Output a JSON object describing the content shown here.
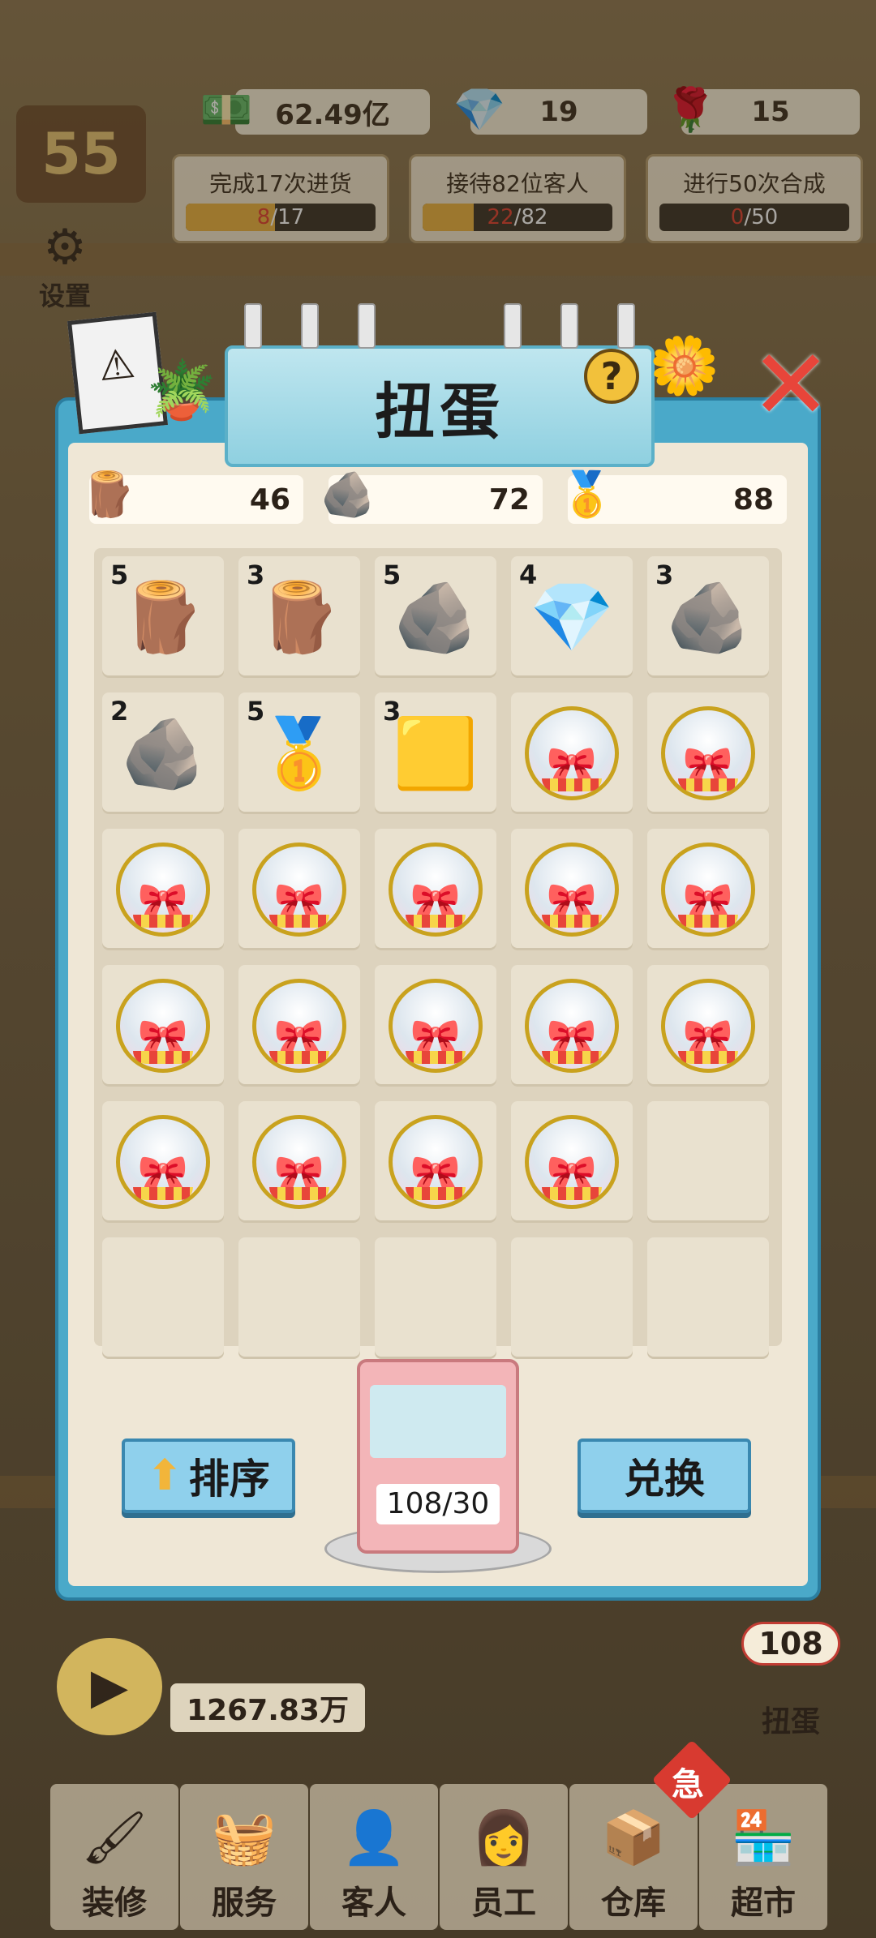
{
  "currency": {
    "money": "62.49亿",
    "gems": "19",
    "roses": "15"
  },
  "level": "55",
  "quests": [
    {
      "title": "完成17次进货",
      "current": "8",
      "total": "/17",
      "progress": 0.47
    },
    {
      "title": "接待82位客人",
      "current": "22",
      "total": "/82",
      "progress": 0.27
    },
    {
      "title": "进行50次合成",
      "current": "0",
      "total": "/50",
      "progress": 0.0
    }
  ],
  "side": {
    "settings": "设置"
  },
  "panel": {
    "title": "扭蛋",
    "help": "?",
    "resources": [
      {
        "icon": "wood-plank-icon",
        "value": "46"
      },
      {
        "icon": "stone-icon",
        "value": "72"
      },
      {
        "icon": "gold-bar-icon",
        "value": "88"
      }
    ],
    "grid": [
      {
        "type": "plank",
        "count": "5"
      },
      {
        "type": "logs",
        "count": "3"
      },
      {
        "type": "stone",
        "count": "5"
      },
      {
        "type": "crystal",
        "count": "4"
      },
      {
        "type": "rock-pile",
        "count": "3"
      },
      {
        "type": "blue-rock",
        "count": "2"
      },
      {
        "type": "gold-bars",
        "count": "5"
      },
      {
        "type": "gold-nuggets",
        "count": "3"
      },
      {
        "type": "capsule",
        "count": ""
      },
      {
        "type": "capsule",
        "count": ""
      },
      {
        "type": "capsule",
        "count": ""
      },
      {
        "type": "capsule",
        "count": ""
      },
      {
        "type": "capsule",
        "count": ""
      },
      {
        "type": "capsule",
        "count": ""
      },
      {
        "type": "capsule",
        "count": ""
      },
      {
        "type": "capsule",
        "count": ""
      },
      {
        "type": "capsule",
        "count": ""
      },
      {
        "type": "capsule",
        "count": ""
      },
      {
        "type": "capsule",
        "count": ""
      },
      {
        "type": "capsule",
        "count": ""
      },
      {
        "type": "capsule",
        "count": ""
      },
      {
        "type": "capsule",
        "count": ""
      },
      {
        "type": "capsule",
        "count": ""
      },
      {
        "type": "capsule",
        "count": ""
      },
      {
        "type": "empty",
        "count": ""
      },
      {
        "type": "empty",
        "count": ""
      },
      {
        "type": "empty",
        "count": ""
      },
      {
        "type": "empty",
        "count": ""
      },
      {
        "type": "empty",
        "count": ""
      },
      {
        "type": "empty",
        "count": ""
      }
    ],
    "sort_label": "排序",
    "exchange_label": "兑换",
    "machine_counter": "108/30"
  },
  "bottom": {
    "cash": "1267.83万",
    "gacha_badge": "108",
    "gacha_label": "扭蛋",
    "urgent": "急"
  },
  "nav": [
    {
      "label": "装修",
      "icon": "paintbrush-icon"
    },
    {
      "label": "服务",
      "icon": "service-icon"
    },
    {
      "label": "客人",
      "icon": "customer-icon"
    },
    {
      "label": "员工",
      "icon": "staff-icon"
    },
    {
      "label": "仓库",
      "icon": "warehouse-icon"
    },
    {
      "label": "超市",
      "icon": "supermarket-icon"
    }
  ]
}
